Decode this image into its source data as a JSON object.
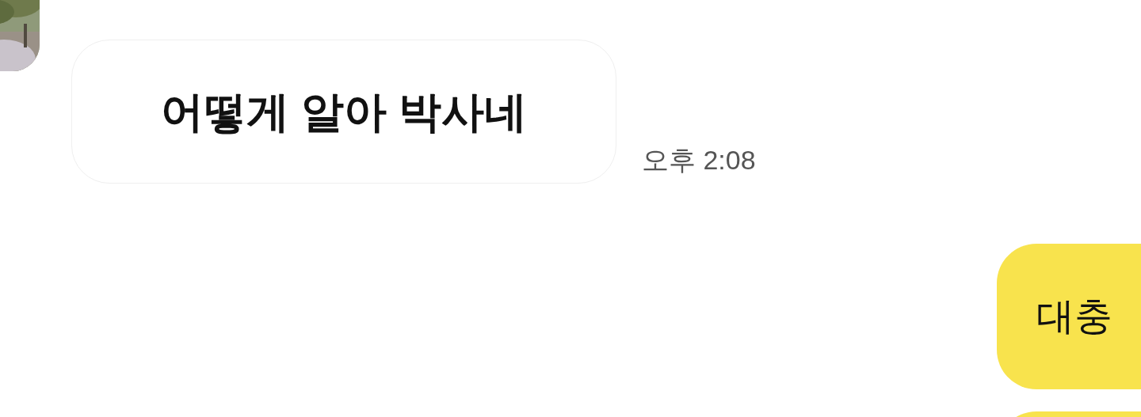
{
  "messages": [
    {
      "kind": "received",
      "text": "어떻게 알아 박사네",
      "time": "오후 2:08"
    },
    {
      "kind": "sent",
      "text": "대충"
    },
    {
      "kind": "sent"
    }
  ]
}
